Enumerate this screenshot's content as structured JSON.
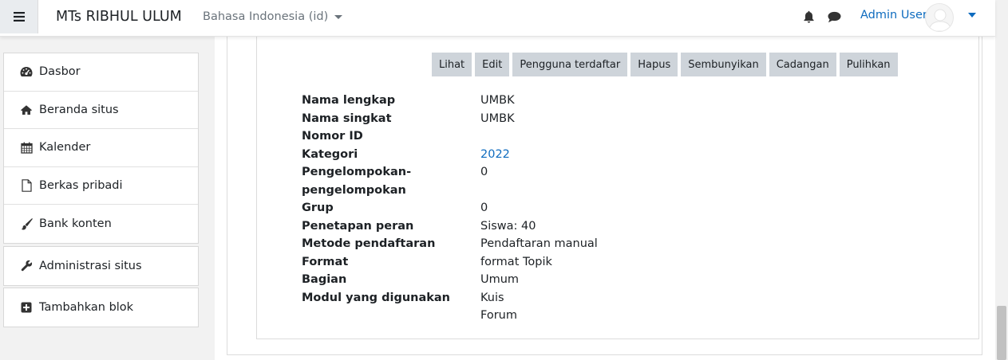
{
  "navbar": {
    "brand": "MTs RIBHUL ULUM",
    "language": "Bahasa Indonesia (id)",
    "user_name": "Admin User"
  },
  "sidebar": {
    "items": [
      {
        "label": "Dasbor",
        "icon": "dashboard-icon"
      },
      {
        "label": "Beranda situs",
        "icon": "home-icon"
      },
      {
        "label": "Kalender",
        "icon": "calendar-icon"
      },
      {
        "label": "Berkas pribadi",
        "icon": "file-icon"
      },
      {
        "label": "Bank konten",
        "icon": "paintbrush-icon"
      }
    ],
    "admin_label": "Administrasi situs",
    "add_block_label": "Tambahkan blok"
  },
  "actions": {
    "view": "Lihat",
    "edit": "Edit",
    "enrolled": "Pengguna terdaftar",
    "delete": "Hapus",
    "hide": "Sembunyikan",
    "backup": "Cadangan",
    "restore": "Pulihkan"
  },
  "details": {
    "fullname_label": "Nama lengkap",
    "fullname": "UMBK",
    "shortname_label": "Nama singkat",
    "shortname": "UMBK",
    "idnumber_label": "Nomor ID",
    "idnumber": "",
    "category_label": "Kategori",
    "category": "2022",
    "groupings_label_1": "Pengelompokan-",
    "groupings_label_2": "pengelompokan",
    "groupings": "0",
    "groups_label": "Grup",
    "groups": "0",
    "roles_label": "Penetapan peran",
    "roles": "Siswa: 40",
    "enrol_label": "Metode pendaftaran",
    "enrol": "Pendaftaran manual",
    "format_label": "Format",
    "format": "format Topik",
    "sections_label": "Bagian",
    "sections": "Umum",
    "modules_label": "Modul yang digunakan",
    "module_1": "Kuis",
    "module_2": "Forum"
  },
  "colors": {
    "link": "#0f6cbf",
    "button_bg": "#ced4da",
    "page_bg": "#f2f2f2"
  }
}
